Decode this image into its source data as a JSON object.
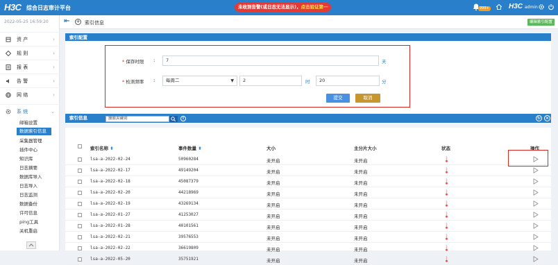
{
  "topbar": {
    "logo": "H3C",
    "app_title": "综合日志审计平台",
    "alert_prefix": "未收到告警(或日志无法显示)，",
    "alert_highlight": "点击验证第一",
    "notification_count": "999+",
    "brand": "H3C",
    "user": "admin"
  },
  "sidebar": {
    "datetime": "2022-05-25 16:59:20",
    "items": [
      {
        "label": "资 产",
        "icon": "asset-icon"
      },
      {
        "label": "规 则",
        "icon": "rule-icon"
      },
      {
        "label": "报 表",
        "icon": "report-icon"
      },
      {
        "label": "告 警",
        "icon": "alarm-icon"
      },
      {
        "label": "网 络",
        "icon": "network-icon"
      },
      {
        "label": "系 统",
        "icon": "system-icon"
      }
    ],
    "subitems": [
      "邮箱设置",
      "数据索引信息",
      "采集器管理",
      "插件中心",
      "知识库",
      "日志摘要",
      "数据库导入",
      "日志导入",
      "日志监测",
      "数据备份",
      "许可信息",
      "ping工具",
      "关机重启"
    ],
    "active_subitem": "数据索引信息"
  },
  "breadcrumb": {
    "title": "索引信息",
    "edit_button": "编辑索引配置"
  },
  "config": {
    "header": "索引配置",
    "retention_label": "保存时限",
    "retention_value": "7",
    "retention_unit": "天",
    "frequency_label": "检测频率",
    "frequency_select": "每周二",
    "frequency_day": "2",
    "hour": "20",
    "hour_unit": "时",
    "minute_unit": "分",
    "submit": "提交",
    "cancel": "取消"
  },
  "table": {
    "header": "索引信息",
    "search_placeholder": "搜索关键词",
    "columns": [
      "索引名称",
      "事件数量",
      "大小",
      "主分片大小",
      "状态",
      "操作"
    ],
    "rows": [
      {
        "name": "lsa-a-2022-02-24",
        "count": "50960284",
        "size": "未开启",
        "primary": "未开启"
      },
      {
        "name": "lsa-a-2022-02-17",
        "count": "49149204",
        "size": "未开启",
        "primary": "未开启"
      },
      {
        "name": "lsa-a-2022-02-18",
        "count": "45087379",
        "size": "未开启",
        "primary": "未开启"
      },
      {
        "name": "lsa-a-2022-02-20",
        "count": "44218969",
        "size": "未开启",
        "primary": "未开启"
      },
      {
        "name": "lsa-a-2022-02-19",
        "count": "43269134",
        "size": "未开启",
        "primary": "未开启"
      },
      {
        "name": "lsa-a-2022-01-27",
        "count": "41253027",
        "size": "未开启",
        "primary": "未开启"
      },
      {
        "name": "lsa-a-2022-01-28",
        "count": "40101561",
        "size": "未开启",
        "primary": "未开启"
      },
      {
        "name": "lsa-a-2022-02-21",
        "count": "39576553",
        "size": "未开启",
        "primary": "未开启"
      },
      {
        "name": "lsa-a-2022-02-22",
        "count": "36619809",
        "size": "未开启",
        "primary": "未开启"
      },
      {
        "name": "lsa-a-2022-05-20",
        "count": "35751921",
        "size": "未开启",
        "primary": "未开启"
      }
    ]
  },
  "colors": {
    "primary": "#2a7fca",
    "danger": "#d9251d",
    "submit": "#4a90e2",
    "cancel": "#c8962e",
    "success": "#5cb85c"
  }
}
